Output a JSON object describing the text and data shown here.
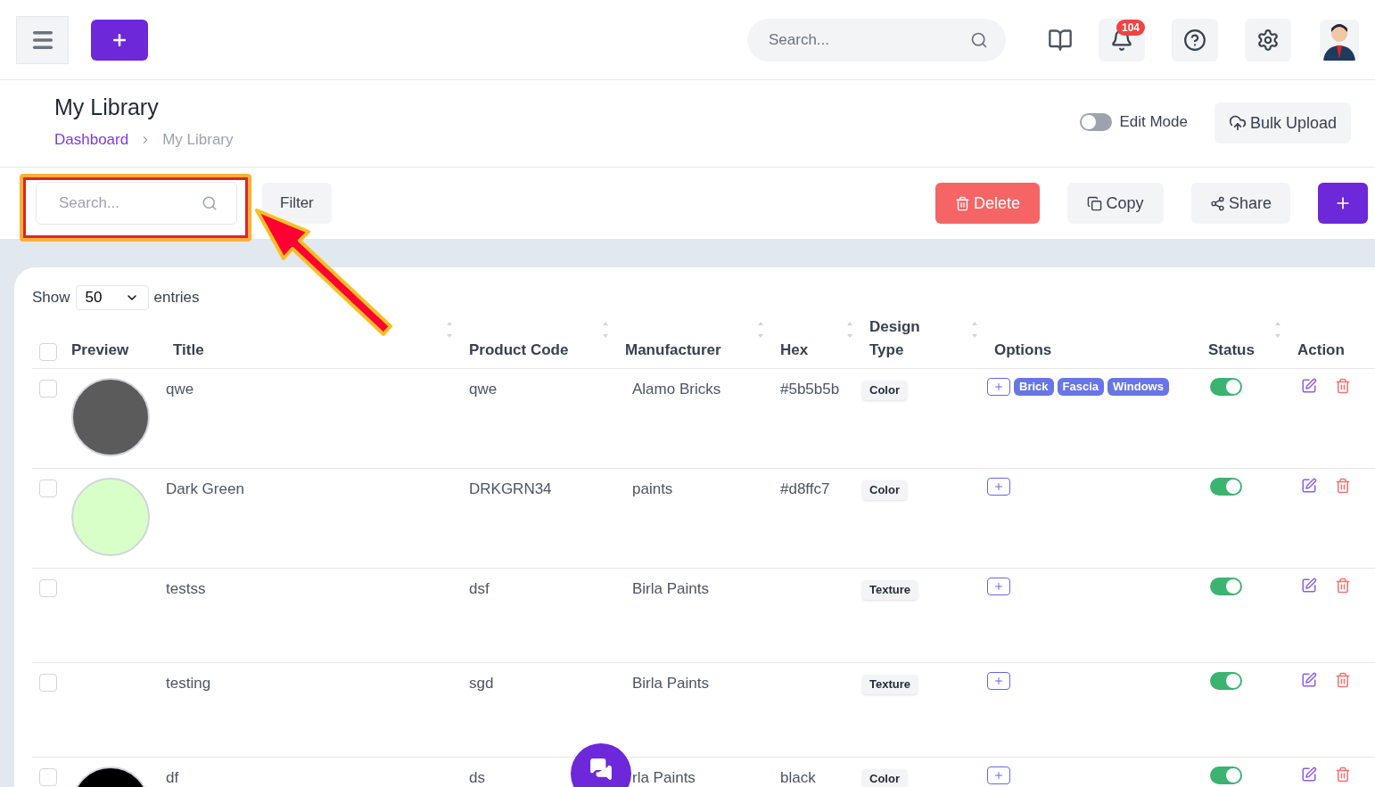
{
  "header": {
    "search": {
      "placeholder": "Search..."
    },
    "notifications": "104"
  },
  "page": {
    "title": "My Library",
    "breadcrumb": [
      {
        "label": "Dashboard",
        "current": false
      },
      {
        "label": "My Library",
        "current": true
      }
    ],
    "edit_mode": {
      "label": "Edit Mode",
      "on": false
    },
    "bulk_upload": "Bulk Upload"
  },
  "toolbar": {
    "search": {
      "placeholder": "Search..."
    },
    "filter": "Filter",
    "delete": "Delete",
    "copy": "Copy",
    "share": "Share"
  },
  "table": {
    "show_label": "Show",
    "page_size": "50",
    "entries_label": "entries",
    "select_all_checked": false,
    "columns": [
      {
        "label": "Preview",
        "sortable": false
      },
      {
        "label": "Title",
        "sortable": true
      },
      {
        "label": "Product Code",
        "sortable": true
      },
      {
        "label": "Manufacturer",
        "sortable": true
      },
      {
        "label": "Hex",
        "sortable": true
      },
      {
        "label": "Design Type",
        "sortable": true
      },
      {
        "label": "Options",
        "sortable": false
      },
      {
        "label": "Status",
        "sortable": true
      },
      {
        "label": "Action",
        "sortable": false
      }
    ],
    "rows": [
      {
        "checked": false,
        "title": "qwe",
        "code": "qwe",
        "manufacturer": "Alamo Bricks",
        "hex": "#5b5b5b",
        "design_type": "Color",
        "options": [
          "Brick",
          "Fascia",
          "Windows"
        ],
        "status": true
      },
      {
        "checked": false,
        "title": "Dark Green",
        "code": "DRKGRN34",
        "manufacturer": "paints",
        "hex": "#d8ffc7",
        "design_type": "Color",
        "options": [],
        "status": true
      },
      {
        "checked": false,
        "title": "testss",
        "code": "dsf",
        "manufacturer": "Birla Paints",
        "design_type": "Texture",
        "options": [],
        "status": true
      },
      {
        "checked": false,
        "title": "testing",
        "code": "sgd",
        "manufacturer": "Birla Paints",
        "design_type": "Texture",
        "options": [],
        "status": true
      },
      {
        "checked": false,
        "title": "df",
        "code": "ds",
        "manufacturer": "rla Paints",
        "hex": "black",
        "design_type": "Color",
        "options": [],
        "status": true
      }
    ]
  }
}
